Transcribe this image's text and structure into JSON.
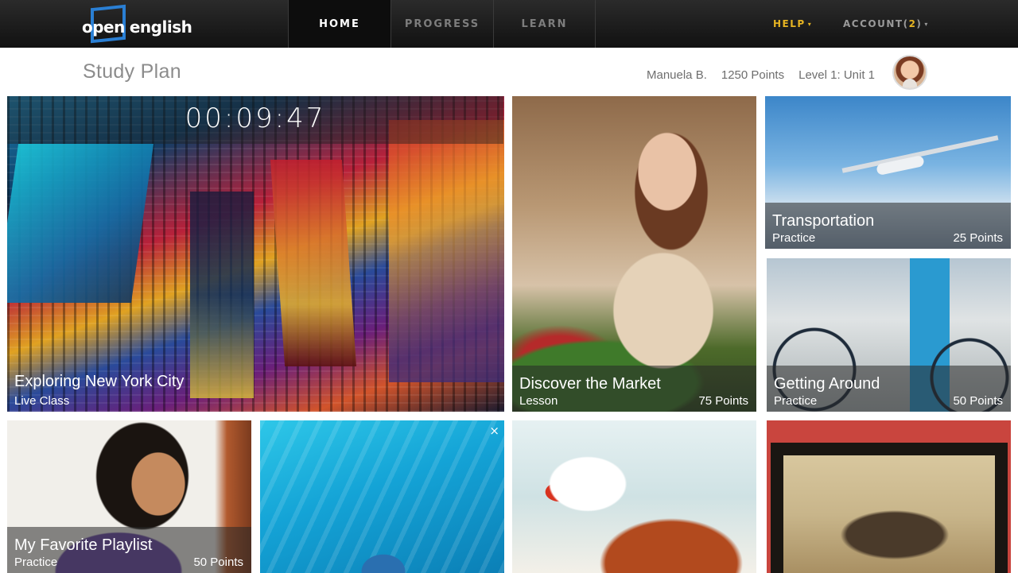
{
  "brand": {
    "logo_line1": "open",
    "logo_line2": "english",
    "accent": "#2a7fd4"
  },
  "nav": {
    "tabs": [
      {
        "label": "HOME",
        "active": true
      },
      {
        "label": "PROGRESS",
        "active": false
      },
      {
        "label": "LEARN",
        "active": false
      }
    ],
    "help_label": "HELP",
    "account_label": "ACCOUNT",
    "account_count_open": " (",
    "account_count": "2",
    "account_count_close": ")",
    "caret": "▾",
    "help_color": "#e6b422"
  },
  "header": {
    "title": "Study Plan",
    "user_name": "Manuela B.",
    "points": "1250 Points",
    "level": "Level 1:  Unit 1"
  },
  "featured": {
    "timer": "00:09:47"
  },
  "tiles": [
    {
      "title": "Exploring New York City",
      "type": "Live Class",
      "points": ""
    },
    {
      "title": "Discover the Market",
      "type": "Lesson",
      "points": "75 Points"
    },
    {
      "title": "Transportation",
      "type": "Practice",
      "points": "25 Points"
    },
    {
      "title": "Getting Around",
      "type": "Practice",
      "points": "50 Points"
    },
    {
      "title": "My Favorite Playlist",
      "type": "Practice",
      "points": "50 Points"
    }
  ],
  "close_glyph": "×"
}
